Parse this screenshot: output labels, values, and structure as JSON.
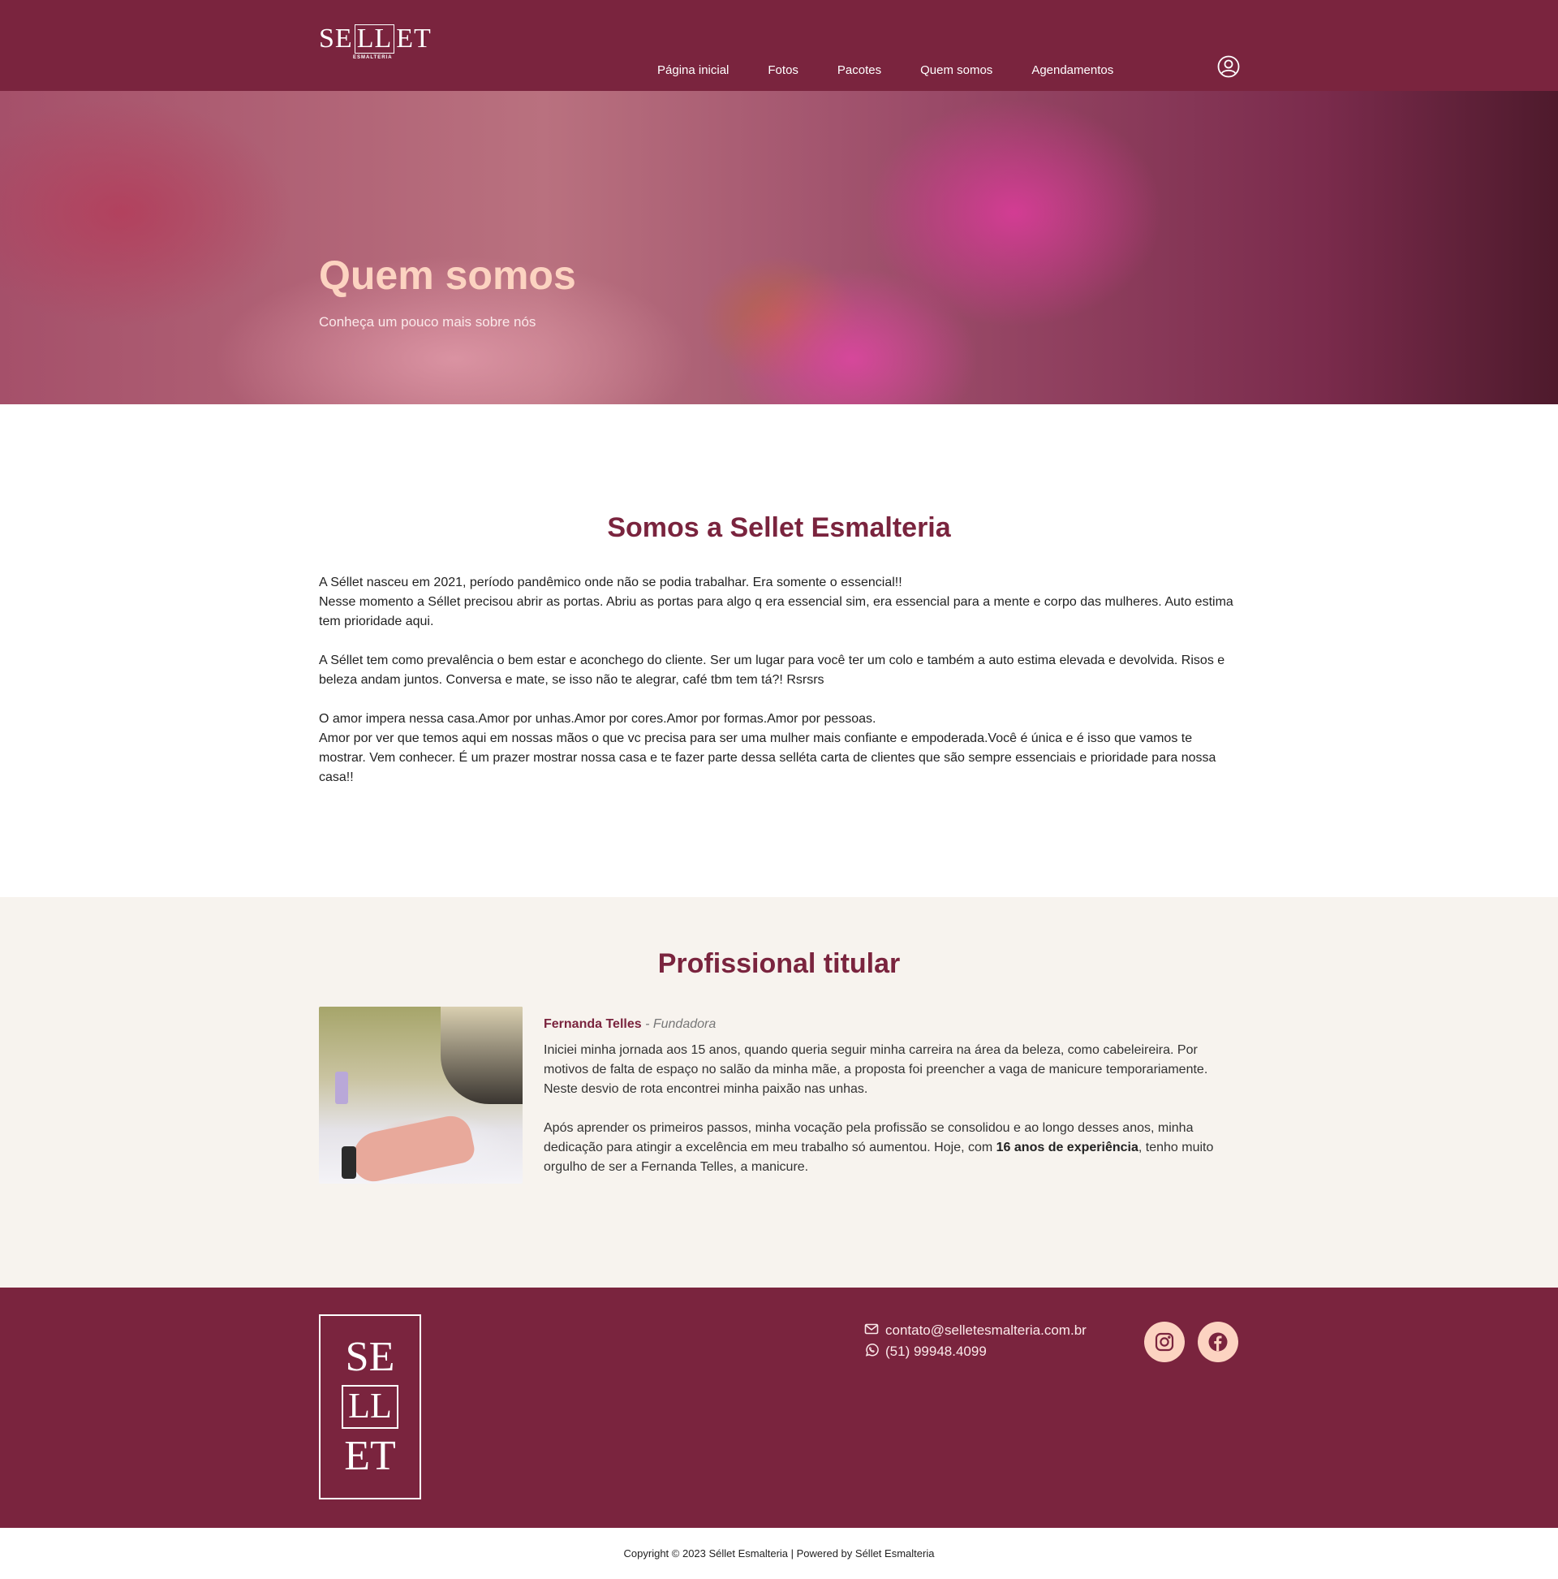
{
  "brand": {
    "logo_left": "SE",
    "logo_box": "LL",
    "logo_right": "ET",
    "logo_sub": "ESMALTERIA",
    "primary_color": "#7a243e",
    "accent_color": "#fcd3c1"
  },
  "nav": {
    "items": [
      {
        "label": "Página inicial",
        "active": false
      },
      {
        "label": "Fotos",
        "active": false
      },
      {
        "label": "Pacotes",
        "active": false
      },
      {
        "label": "Quem somos",
        "active": true
      },
      {
        "label": "Agendamentos",
        "active": false
      }
    ],
    "user_icon": "user-circle-icon"
  },
  "hero": {
    "title": "Quem somos",
    "subtitle": "Conheça um pouco mais sobre nós"
  },
  "about": {
    "title": "Somos a Sellet Esmalteria",
    "paragraphs": [
      [
        "A Séllet nasceu em 2021, período pandêmico onde não se podia trabalhar. Era somente o essencial!!",
        "Nesse momento a Séllet precisou abrir as portas. Abriu as portas para algo q era essencial sim, era essencial para a mente e corpo das mulheres. Auto estima tem prioridade aqui."
      ],
      [
        "A Séllet tem como prevalência o bem estar e aconchego do cliente. Ser um lugar para você ter um colo e também a auto estima elevada e devolvida. Risos e beleza andam juntos. Conversa e mate, se isso não te alegrar, café tbm tem tá?! Rsrsrs"
      ],
      [
        "O amor impera nessa casa.Amor por unhas.Amor por cores.Amor por formas.Amor por pessoas.",
        "Amor por ver que temos aqui em nossas mãos o que vc precisa para ser uma mulher mais confiante e empoderada.Você é única e é isso que vamos te mostrar. Vem conhecer. É um prazer mostrar nossa casa e te fazer parte dessa selléta carta de clientes que são sempre essenciais e prioridade para nossa casa!!"
      ]
    ]
  },
  "professional": {
    "title": "Profissional titular",
    "name": "Fernanda Telles",
    "role": " - Fundadora",
    "p1": "Iniciei minha jornada aos 15 anos, quando queria seguir minha carreira na área da beleza, como cabeleireira. Por motivos de falta de espaço no salão da minha mãe, a proposta foi preencher a vaga de manicure temporariamente. Neste desvio de rota encontrei minha paixão nas unhas.",
    "p2_start": "Após aprender os primeiros passos, minha vocação pela profissão se consolidou e ao longo desses anos, minha dedicação para atingir a excelência em meu trabalho só aumentou. Hoje, com ",
    "p2_bold": "16 anos de experiência",
    "p2_end": ", tenho muito orgulho de ser a Fernanda Telles, a manicure."
  },
  "footer": {
    "logo_top": "SE",
    "logo_mid": "LL",
    "logo_bottom": "ET",
    "email": "contato@selletesmalteria.com.br",
    "phone": "(51) 99948.4099",
    "email_icon": "envelope-icon",
    "phone_icon": "whatsapp-icon",
    "socials": [
      "instagram-icon",
      "facebook-icon"
    ]
  },
  "copyright": "Copyright © 2023 Séllet Esmalteria | Powered by Séllet Esmalteria"
}
